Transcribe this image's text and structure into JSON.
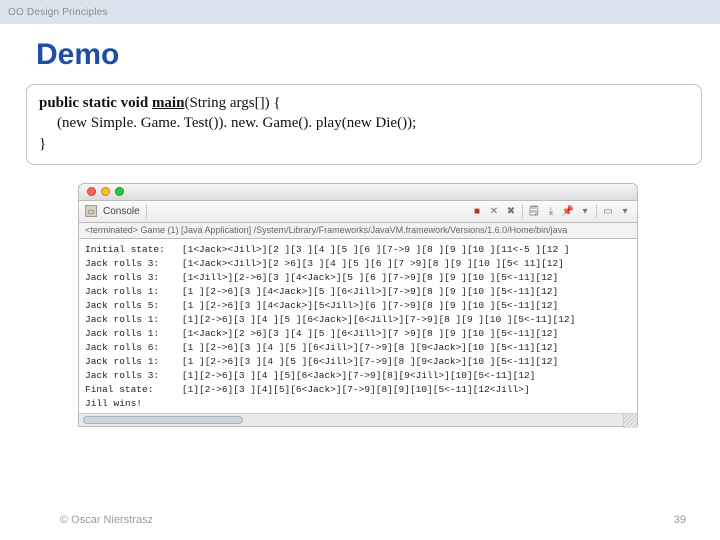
{
  "header": {
    "breadcrumb": "OO Design Principles"
  },
  "title": "Demo",
  "code": {
    "kw1": "public static void ",
    "main": "main",
    "sig": "(String args[]) {",
    "body": "(new Simple. Game. Test()). new. Game(). play(new Die());",
    "close": "}"
  },
  "console": {
    "tab_label": "Console",
    "status_line": "<terminated> Game (1) [Java Application] /System/Library/Frameworks/JavaVM.framework/Versions/1.6.0/Home/bin/java",
    "lines": [
      "Initial state:   [1<Jack><Jill>][2 ][3 ][4 ][5 ][6 ][7->9 ][8 ][9 ][10 ][11<-5 ][12 ]",
      "Jack rolls 3:    [1<Jack><Jill>][2 >6][3 ][4 ][5 ][6 ][7 >9][8 ][9 ][10 ][5< 11][12]",
      "Jack rolls 3:    [1<Jill>][2->6][3 ][4<Jack>][5 ][6 ][7->9][8 ][9 ][10 ][5<-11][12]",
      "Jack rolls 1:    [1 ][2->6][3 ][4<Jack>][5 ][6<Jill>][7->9][8 ][9 ][10 ][5<-11][12]",
      "Jack rolls 5:    [1 ][2->6][3 ][4<Jack>][5<Jill>][6 ][7->9][8 ][9 ][10 ][5<-11][12]",
      "Jack rolls 1:    [1][2->6][3 ][4 ][5 ][6<Jack>][6<Jill>][7->9][8 ][9 ][10 ][5<-11][12]",
      "Jack rolls 1:    [1<Jack>][2 >6][3 ][4 ][5 ][6<Jill>][7 >9][8 ][9 ][10 ][5<-11][12]",
      "Jack rolls 6:    [1 ][2->6][3 ][4 ][5 ][6<Jill>][7->9][8 ][9<Jack>][10 ][5<-11][12]",
      "Jack rolls 1:    [1 ][2->6][3 ][4 ][5 ][6<Jill>][7->9][8 ][9<Jack>][10 ][5<-11][12]",
      "Jack rolls 3:    [1][2->6][3 ][4 ][5][6<Jack>][7->9][8][9<Jill>][10][5<-11][12]",
      "Final state:     [1][2->6][3 ][4][5][6<Jack>][7->9][8][9][10][5<-11][12<Jill>]",
      "Jill wins!"
    ]
  },
  "footer": {
    "copyright": "© Oscar Nierstrasz",
    "page": "39"
  }
}
